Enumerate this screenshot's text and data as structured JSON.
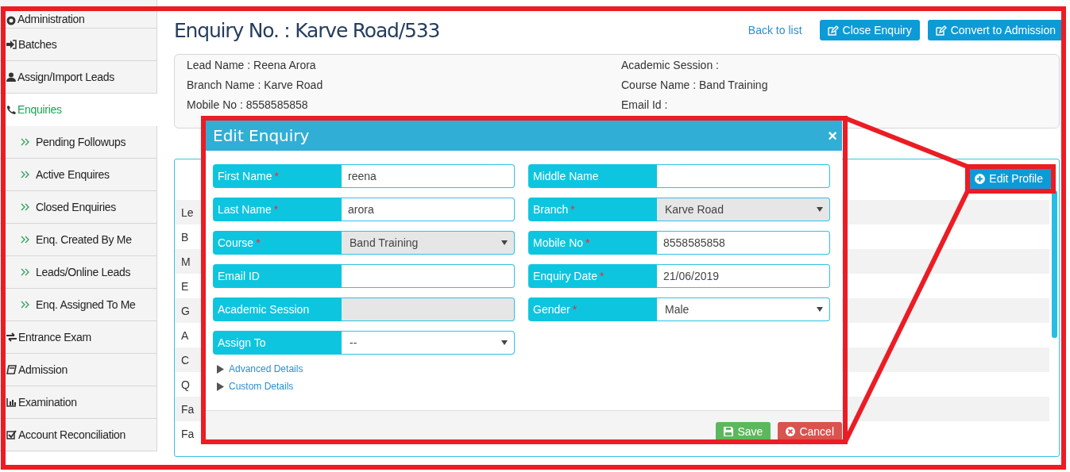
{
  "sidebar": {
    "items": [
      {
        "label": "Administration",
        "selected": false
      },
      {
        "label": "Batches",
        "selected": false
      },
      {
        "label": "Assign/Import Leads",
        "selected": false
      },
      {
        "label": "Enquiries",
        "selected": true,
        "expanded": true,
        "children": [
          {
            "label": "Pending Followups",
            "selected": false
          },
          {
            "label": "Active Enquires",
            "selected": false
          },
          {
            "label": "Closed Enquiries",
            "selected": false
          },
          {
            "label": "Enq. Created By Me",
            "selected": false
          },
          {
            "label": "Leads/Online Leads",
            "selected": false
          },
          {
            "label": "Enq. Assigned To Me",
            "selected": false
          }
        ]
      },
      {
        "label": "Entrance Exam",
        "selected": false
      },
      {
        "label": "Admission",
        "selected": false
      },
      {
        "label": "Examination",
        "selected": false
      },
      {
        "label": "Account Reconciliation",
        "selected": false
      }
    ]
  },
  "page": {
    "title": "Enquiry No. : Karve Road/533",
    "back_link": "Back to list",
    "buttons": [
      "Close Enquiry",
      "Convert to Admission"
    ]
  },
  "summary": {
    "left": [
      "Lead Name : Reena Arora",
      "Branch Name : Karve Road",
      "Mobile No : 8558585858"
    ],
    "right": [
      "Academic Session :",
      "Course Name : Band Training",
      "Email Id :"
    ]
  },
  "profile_panel": {
    "button": "Edit Profile",
    "row_labels": [
      "Le",
      "B",
      "M",
      "E",
      "G",
      "A",
      "C",
      "Q",
      "Fa",
      "Fa"
    ]
  },
  "modal": {
    "title": "Edit Enquiry",
    "close": "×",
    "fields": [
      {
        "label": "First Name",
        "required": true,
        "kind": "text",
        "value": "reena",
        "disabled": false
      },
      {
        "label": "Middle Name",
        "required": false,
        "kind": "text",
        "disabled": false
      },
      {
        "label": "Last Name",
        "required": true,
        "kind": "text",
        "value": "arora",
        "disabled": false
      },
      {
        "label": "Branch",
        "required": true,
        "kind": "select",
        "value": "Karve Road",
        "disabled": true
      },
      {
        "label": "Course",
        "required": true,
        "kind": "select",
        "value": "Band Training",
        "disabled": true
      },
      {
        "label": "Mobile No",
        "required": true,
        "kind": "text",
        "value": "8558585858",
        "disabled": false
      },
      {
        "label": "Email ID",
        "required": false,
        "kind": "text",
        "disabled": false
      },
      {
        "label": "Enquiry Date",
        "required": true,
        "kind": "text",
        "value": "21/06/2019",
        "disabled": false
      },
      {
        "label": "Academic Session",
        "required": false,
        "kind": "text",
        "disabled": true
      },
      {
        "label": "Gender",
        "required": true,
        "kind": "select",
        "value": "Male",
        "disabled": false
      },
      {
        "label": "Assign To",
        "required": false,
        "kind": "select",
        "value": "--",
        "disabled": false
      }
    ],
    "sections": [
      {
        "label": "Advanced Details",
        "expanded": false
      },
      {
        "label": "Custom Details",
        "expanded": false
      }
    ],
    "required_mark": "*",
    "actions": [
      {
        "label": "Save",
        "kind": "save"
      },
      {
        "label": "Cancel",
        "kind": "cancel"
      }
    ]
  }
}
